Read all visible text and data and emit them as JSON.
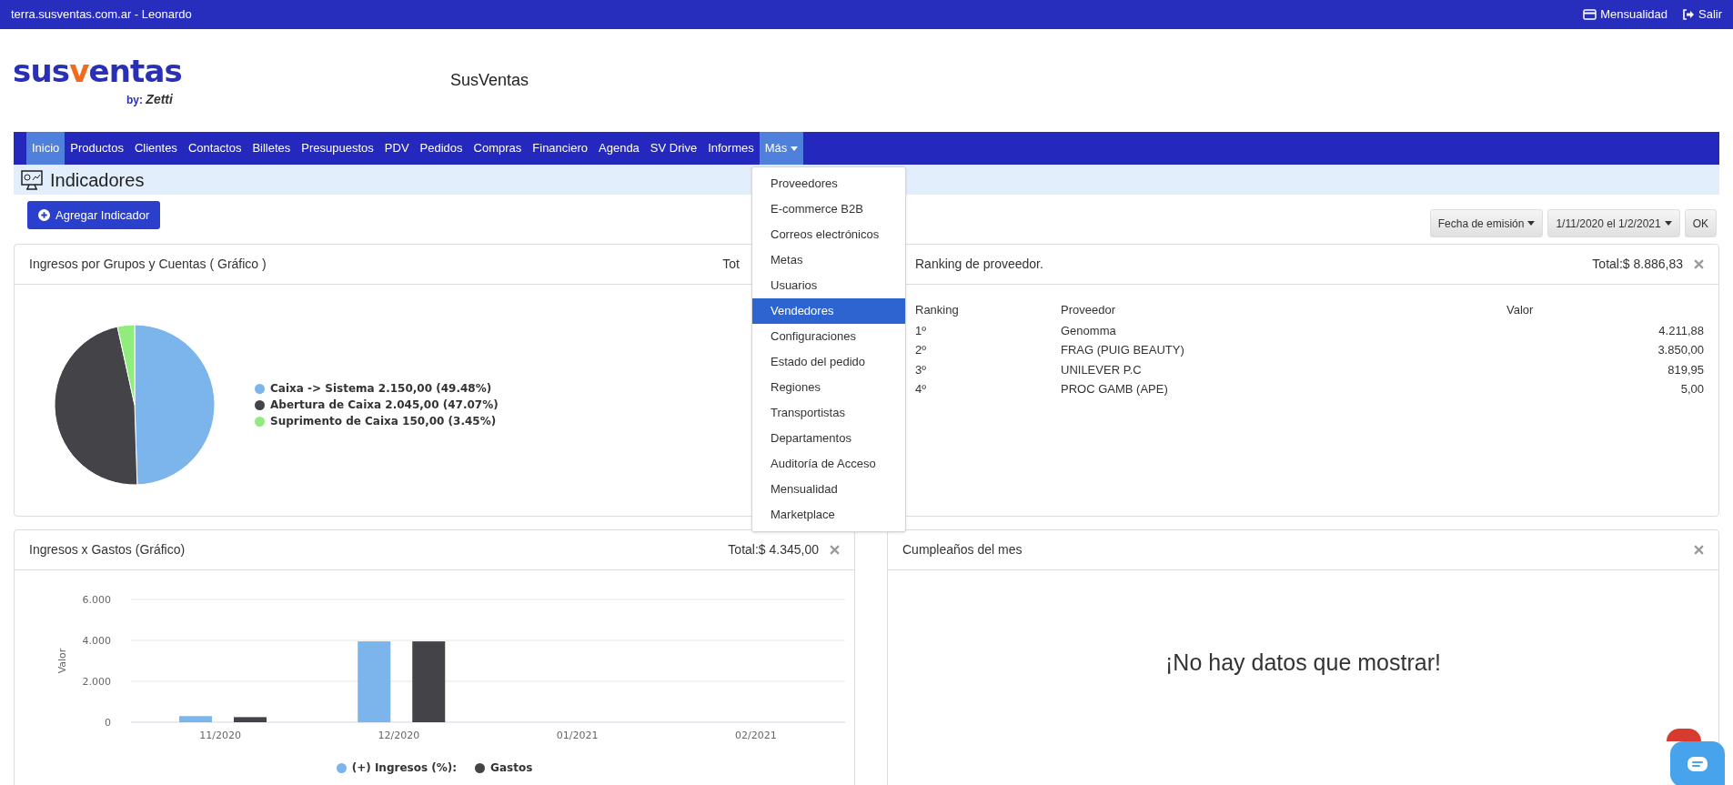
{
  "top_bar": {
    "site": "terra.susventas.com.ar",
    "separator": " - ",
    "user": "Leonardo",
    "links": [
      {
        "kind": "card",
        "label": "Mensualidad"
      },
      {
        "kind": "exit",
        "label": "Salir"
      }
    ]
  },
  "header": {
    "logo": {
      "main_start": "sus",
      "main_accent": "v",
      "main_end": "entas",
      "by": "by:",
      "brand": "Zetti"
    },
    "title": "SusVentas"
  },
  "nav": [
    {
      "label": "Inicio",
      "selected": true
    },
    {
      "label": "Productos",
      "selected": false
    },
    {
      "label": "Clientes",
      "selected": false
    },
    {
      "label": "Contactos",
      "selected": false
    },
    {
      "label": "Billetes",
      "selected": false
    },
    {
      "label": "Presupuestos",
      "selected": false
    },
    {
      "label": "PDV",
      "selected": false
    },
    {
      "label": "Pedidos",
      "selected": false
    },
    {
      "label": "Compras",
      "selected": false
    },
    {
      "label": "Financiero",
      "selected": false
    },
    {
      "label": "Agenda",
      "selected": false
    },
    {
      "label": "SV Drive",
      "selected": false
    },
    {
      "label": "Informes",
      "selected": false
    },
    {
      "label": "Más",
      "expanded": true
    }
  ],
  "dropdown": [
    {
      "label": "Proveedores",
      "selected": false
    },
    {
      "label": "E-commerce B2B",
      "selected": false
    },
    {
      "label": "Correos electrónicos",
      "selected": false
    },
    {
      "label": "Metas",
      "selected": false
    },
    {
      "label": "Usuarios",
      "selected": false
    },
    {
      "label": "Vendedores",
      "selected": true
    },
    {
      "label": "Configuraciones",
      "selected": false
    },
    {
      "label": "Estado del pedido",
      "selected": false
    },
    {
      "label": "Regiones",
      "selected": false
    },
    {
      "label": "Transportistas",
      "selected": false
    },
    {
      "label": "Departamentos",
      "selected": false
    },
    {
      "label": "Auditoría de Acceso",
      "selected": false
    },
    {
      "label": "Mensualidad",
      "selected": false
    },
    {
      "label": "Marketplace",
      "selected": false
    }
  ],
  "page_title": "Indicadores",
  "add_button": "Agregar Indicador",
  "filters": {
    "date_type": "Fecha de emisión",
    "range": "1/11/2020 el 1/2/2021",
    "ok": "OK"
  },
  "panels": [
    {
      "kind": "pie",
      "title": "Ingresos por Grupos y Cuentas ( Gráfico )",
      "total": "Tot",
      "chart_data": {
        "type": "pie",
        "categories": [
          "Caixa -> Sistema 2.150,00 (49.48%)",
          "Abertura de Caixa 2.045,00 (47.07%)",
          "Suprimento de Caixa 150,00 (3.45%)"
        ],
        "values": [
          2150,
          2045,
          150
        ],
        "legend": "right",
        "colors": [
          "#7cb5ec",
          "#434348",
          "#90ed7d"
        ]
      }
    },
    {
      "kind": "ranking",
      "title": "Ranking de proveedor.",
      "total": "Total:$ 8.886,83",
      "columns": [
        "Ranking",
        "Proveedor",
        "Valor"
      ],
      "rows": [
        [
          "1º",
          "Genomma",
          "4.211,88"
        ],
        [
          "2º",
          "FRAG (PUIG BEAUTY)",
          "3.850,00"
        ],
        [
          "3º",
          "UNILEVER P.C",
          "819,95"
        ],
        [
          "4º",
          "PROC GAMB (APE)",
          "5,00"
        ]
      ]
    },
    {
      "kind": "bar",
      "title": "Ingresos x Gastos (Gráfico)",
      "total": "Total:$ 4.345,00",
      "chart_data": {
        "type": "bar",
        "ylabel": "Valor",
        "categories": [
          "11/2020",
          "12/2020",
          "01/2021",
          "02/2021"
        ],
        "series": [
          {
            "name": "(+) Ingresos (%):",
            "color": "#7cb5ec",
            "values": [
              300,
              3950,
              0,
              0
            ]
          },
          {
            "name": "Gastos",
            "color": "#434348",
            "values": [
              250,
              3950,
              0,
              0
            ]
          }
        ],
        "legend": "bottom",
        "ylim": [
          0,
          6000
        ],
        "yticks": [
          {
            "value": 0,
            "label": "0"
          },
          {
            "value": 2000,
            "label": "2.000"
          },
          {
            "value": 4000,
            "label": "4.000"
          },
          {
            "value": 6000,
            "label": "6.000"
          }
        ]
      }
    },
    {
      "kind": "empty",
      "title": "Cumpleaños del mes",
      "message": "¡No hay datos que mostrar!"
    }
  ]
}
